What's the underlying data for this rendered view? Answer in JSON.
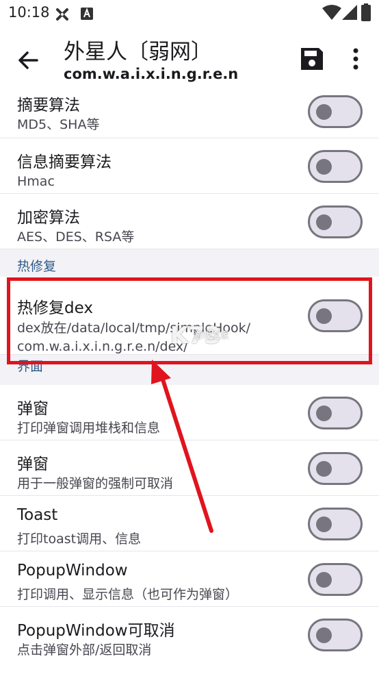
{
  "status_bar": {
    "time": "10:18",
    "icons": [
      "settings-cross-icon",
      "text-a-icon",
      "wifi-icon",
      "cell-signal-icon",
      "battery-icon"
    ]
  },
  "app_bar": {
    "title": "外星人〔弱网〕",
    "subtitle": "com.w.a.i.x.i.n.g.r.e.n",
    "back_icon": "arrow-back-icon",
    "save_icon": "save-icon",
    "more_icon": "more-vert-icon"
  },
  "settings": {
    "crypto_items": [
      {
        "title": "摘要算法",
        "subtitle": "MD5、SHA等",
        "enabled": false
      },
      {
        "title": "信息摘要算法",
        "subtitle": "Hmac",
        "enabled": false
      },
      {
        "title": "加密算法",
        "subtitle": "AES、DES、RSA等",
        "enabled": false
      }
    ],
    "hotfix_header": "热修复",
    "hotfix_item": {
      "title": "热修复dex",
      "subtitle_line1": "dex放在/data/local/tmp/simpleHook/",
      "subtitle_line2": "com.w.a.i.x.i.n.g.r.e.n/dex/",
      "enabled": false
    },
    "ui_header": "界面",
    "ui_items": [
      {
        "title": "弹窗",
        "subtitle": "打印弹窗调用堆栈和信息",
        "enabled": false
      },
      {
        "title": "弹窗",
        "subtitle": "用于一般弹窗的强制可取消",
        "enabled": false
      },
      {
        "title": "Toast",
        "subtitle": "打印toast调用、信息",
        "enabled": false
      },
      {
        "title": "PopupWindow",
        "subtitle": "打印调用、显示信息（也可作为弹窗）",
        "enabled": false
      },
      {
        "title": "PopupWindow可取消",
        "subtitle": "点击弹窗外部/返回取消",
        "enabled": false
      }
    ]
  },
  "watermark": {
    "logo": "K73",
    "text": "游戏之家"
  },
  "colors": {
    "accent": "#2e5a8a",
    "annotation": "#e0141e",
    "switch_track": "#e4e1ec",
    "switch_outline": "#77767f"
  }
}
